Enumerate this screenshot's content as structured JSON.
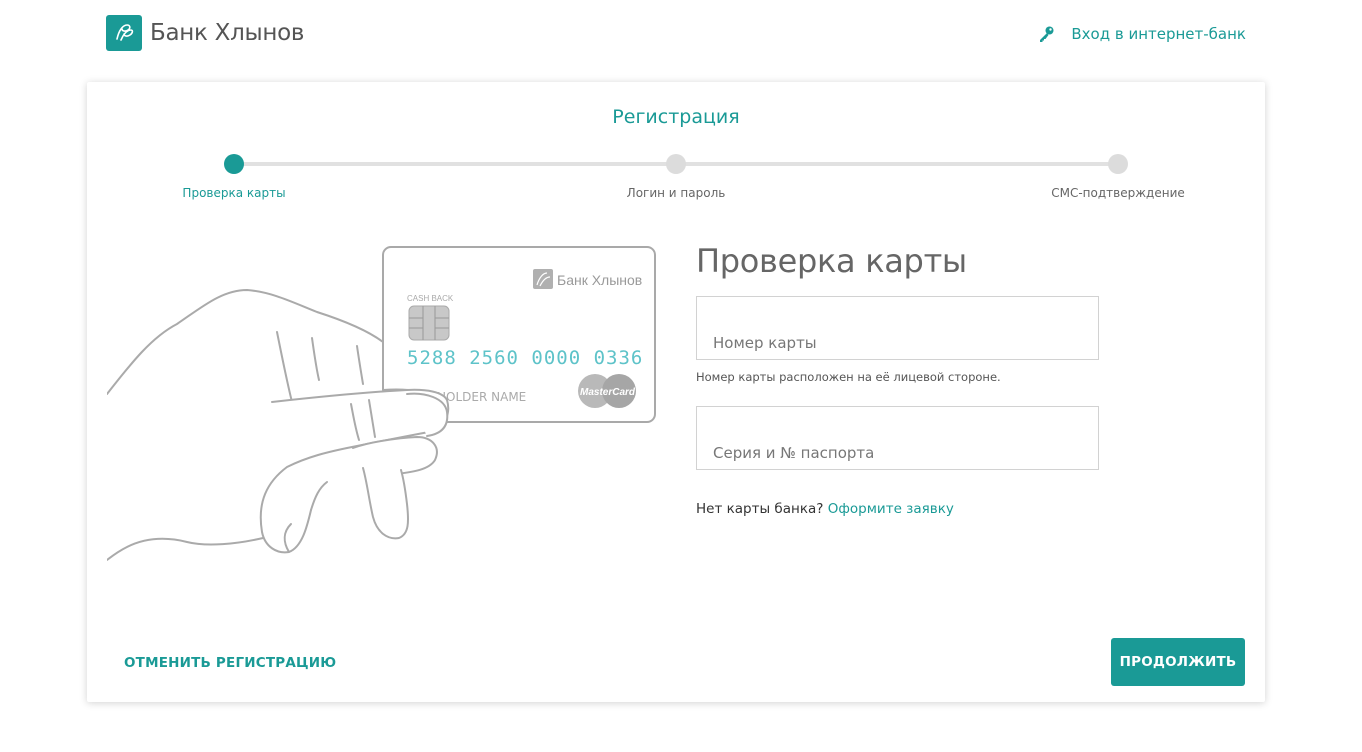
{
  "header": {
    "brand_name": "Банк Хлынов",
    "login_link": "Вход в интернет-банк"
  },
  "registration": {
    "title": "Регистрация",
    "steps": [
      {
        "label": "Проверка карты",
        "active": true
      },
      {
        "label": "Логин и пароль",
        "active": false
      },
      {
        "label": "СМС-подтверждение",
        "active": false
      }
    ]
  },
  "illustration": {
    "card_bank_name": "Банк Хлынов",
    "cash_back": "CASH BACK",
    "card_number": "5288 2560 0000 0336",
    "holder": "HOLDER NAME",
    "network": "MasterCard"
  },
  "form": {
    "title": "Проверка карты",
    "card_number_placeholder": "Номер карты",
    "card_number_value": "",
    "card_hint": "Номер карты расположен на её лицевой стороне.",
    "passport_placeholder": "Серия и № паспорта",
    "passport_value": "",
    "no_card_text": "Нет карты банка?",
    "apply_link": "Оформите заявку"
  },
  "actions": {
    "cancel_label": "ОТМЕНИТЬ РЕГИСТРАЦИЮ",
    "continue_label": "ПРОДОЛЖИТЬ"
  },
  "colors": {
    "accent": "#1a9a96",
    "inactive": "#dcdcdc"
  }
}
